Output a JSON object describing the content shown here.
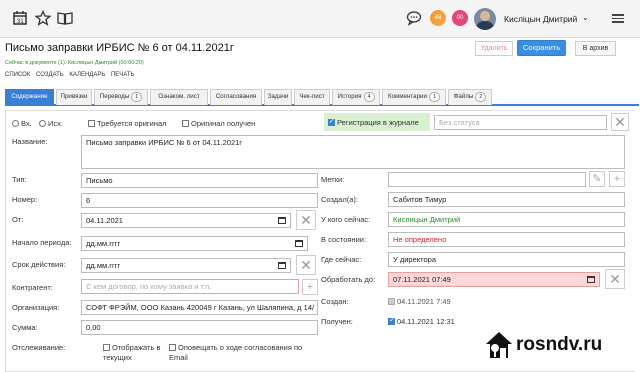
{
  "header": {
    "icons": [
      "calendar-icon",
      "star-icon",
      "book-icon",
      "chat-icon"
    ],
    "badge_orange": "48",
    "badge_pink": "00",
    "user_name": "Кисліцын Дмитрий",
    "colors": {
      "badge_orange": "#f3a13b",
      "badge_pink": "#e0457b",
      "primary": "#3a8ee0"
    }
  },
  "document": {
    "title": "Письмо заправки ИРБИС № 6 от 04.11.2021г",
    "subline": "Сейчас в документе (1): Кислицын Дмитрий (00:00:20)",
    "menu": [
      "СПИСОК",
      "СОЗДАТЬ",
      "КАЛЕНДАРЬ",
      "ПЕЧАТЬ"
    ],
    "delete_label": "Удалить",
    "save_label": "Сохранить",
    "archive_label": "В архив"
  },
  "tabs": [
    {
      "label": "Содержание",
      "count": ""
    },
    {
      "label": "Привязки",
      "count": ""
    },
    {
      "label": "Переводы",
      "count": "1"
    },
    {
      "label": "Ознаком. лист",
      "count": ""
    },
    {
      "label": "Согласования",
      "count": ""
    },
    {
      "label": "Задачи",
      "count": ""
    },
    {
      "label": "Чек-лист",
      "count": ""
    },
    {
      "label": "История",
      "count": "4"
    },
    {
      "label": "Комментарии",
      "count": "1"
    },
    {
      "label": "Файлы",
      "count": "2"
    }
  ],
  "form": {
    "radio_in": "Вх.",
    "radio_out": "Исх.",
    "cb_original_required": "Требуется оригинал",
    "cb_original_received": "Оригинал получен",
    "cb_registration": "Регистрация в журнале",
    "status_placeholder": "Без статуса",
    "name_label": "Название:",
    "name_value": "Письмо заправки ИРБИС № 6 от 04.11.2021г",
    "type_label": "Тип:",
    "type_value": "Письмо",
    "number_label": "Номер:",
    "number_value": "6",
    "from_label": "От:",
    "from_value": "04.11.2021",
    "period_start_label": "Начало периода:",
    "period_start_placeholder": "дд.мм.гггг",
    "validity_label": "Срок действия:",
    "validity_placeholder": "дд.мм.гггг",
    "contractor_label": "Контрагент:",
    "contractor_placeholder": "С кем договор, по кому заявка и т.п.",
    "organization_label": "Организация:",
    "organization_value": "СОФТ ФРЭЙМ, ООО Казань 420049 г Казань, ул Шаляпина, д 14/",
    "sum_label": "Сумма:",
    "sum_value": "0,00",
    "tracking_label": "Отслеживание:",
    "tracking_opt1": "Отображать в текущих",
    "tracking_opt2": "Оповещать о ходе согласования по Email",
    "tags_label": "Метки:",
    "created_by_label": "Создал(а):",
    "created_by_value": "Сабитов Тимур",
    "current_holder_label": "У кого сейчас:",
    "current_holder_value": "Кислицын Дмитрий",
    "state_label": "В состоянии:",
    "state_value": "Не определено",
    "where_now_label": "Где сейчас:",
    "where_now_value": "У директора",
    "process_by_label": "Обработать до:",
    "process_by_value": "07.11.2021 07:49",
    "created_label": "Создан:",
    "created_value": "04.11.2021 7:49",
    "received_label": "Получен:",
    "received_value": "04.11.2021 12:31"
  },
  "watermark": {
    "text": "rosndv.ru"
  }
}
